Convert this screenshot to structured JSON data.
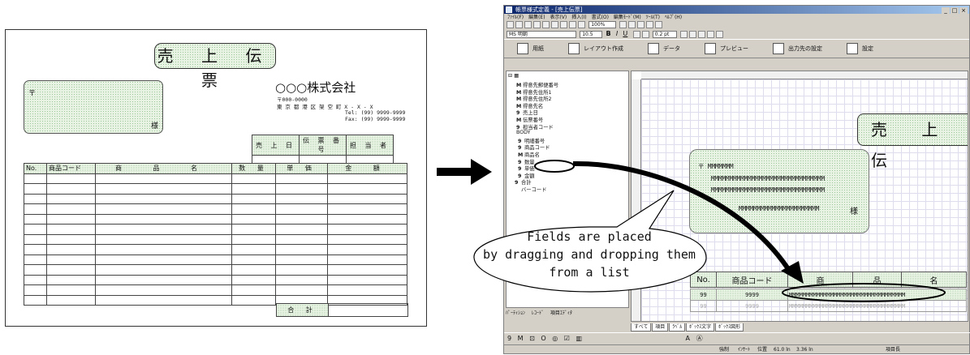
{
  "form": {
    "title": "売 上 伝 票",
    "postal_mark": "〒",
    "honorific": "様",
    "company_name": "○○○株式会社",
    "company_zip": "〒000-0000",
    "company_address": "東 京 都 港 区 架 空 町 X - X - X",
    "company_tel": "Tel: (99) 9999-9999",
    "company_fax": "Fax: (99) 9999-9999",
    "header_cols": [
      "売 上 日",
      "伝 票 番 号",
      "担 当 者"
    ],
    "item_cols": [
      "No.",
      "商品コード",
      "商 品 名",
      "数 量",
      "単 価",
      "金 額"
    ],
    "total_label": "合 計"
  },
  "window": {
    "title": "帳票様式定義 - [売上伝票]",
    "menu": [
      "ﾌｧｲﾙ(F)",
      "編集(E)",
      "表示(V)",
      "挿入(I)",
      "書式(O)",
      "編集ﾓｰﾄﾞ(M)",
      "ﾂｰﾙ(T)",
      "ﾍﾙﾌﾟ(H)"
    ],
    "font_name": "MS 明朝",
    "font_size": "10.5",
    "zoom": "100%",
    "line_width": "0.2 pt",
    "big_buttons": [
      "用紙",
      "レイアウト作成",
      "データ",
      "プレビュー",
      "出力先の設定",
      "設定"
    ],
    "tree": [
      {
        "icon": "M",
        "label": "得意先郵便番号"
      },
      {
        "icon": "M",
        "label": "得意先住所1"
      },
      {
        "icon": "M",
        "label": "得意先住所2"
      },
      {
        "icon": "M",
        "label": "得意先名"
      },
      {
        "icon": "9",
        "label": "売上日"
      },
      {
        "icon": "M",
        "label": "伝票番号"
      },
      {
        "icon": "9",
        "label": "担当者コード"
      },
      {
        "icon": "",
        "label": "BODY"
      },
      {
        "icon": "9",
        "label": "明細番号"
      },
      {
        "icon": "9",
        "label": "商品コード"
      },
      {
        "icon": "M",
        "label": "商品名"
      },
      {
        "icon": "9",
        "label": "数量"
      },
      {
        "icon": "9",
        "label": "単価"
      },
      {
        "icon": "9",
        "label": "金額"
      },
      {
        "icon": "9",
        "label": "合計"
      },
      {
        "icon": "",
        "label": "バーコード"
      }
    ],
    "canvas": {
      "title": "売 上 伝",
      "zip_field": "〒 MMMMMMM",
      "addr1": "MMMMMMMMMMMMMMMMMMMMMMMMMMMMMMM",
      "addr2": "MMMMMMMMMMMMMMMMMMMMMMMMMMMMMMM",
      "name_field": "MMMMMMMMMMMMMMMMMMMMMM",
      "honorific": "様",
      "cols": [
        "No.",
        "商品コード",
        "商",
        "品",
        "名"
      ],
      "row": [
        "99",
        "9999",
        "MMMMMMMMMMMMMMMMMMMMMMMMMMMMMMMMMM"
      ],
      "row_ghost": [
        "99",
        "9999",
        "MMMMMMMMMMMMMMMMMMMMMMMMMMMMMMMMMM"
      ]
    },
    "left_tabs": [
      "ﾊﾟｰﾃｨｼｮﾝ",
      "ﾚｺｰﾄﾞ",
      "項目ｴﾃﾞｨﾀ"
    ],
    "tabs": [
      "すべて",
      "項目",
      "ﾗﾍﾞﾙ",
      "ﾎﾞｯｸｽ文字",
      "ﾎﾞｯｸｽ図形"
    ],
    "drawbar": [
      "9",
      "M",
      "⊡",
      "O",
      "◎",
      "☑",
      "▥",
      "A",
      "Ⓐ"
    ],
    "status": [
      "強制",
      "ｲﾝｻｰﾄ",
      "位置",
      "61.0 ln",
      "3.36 ln",
      "項目長"
    ]
  },
  "callout": {
    "line1": "Fields are placed",
    "line2": "by dragging and dropping them",
    "line3": "from a list"
  },
  "colors": {
    "dot_fill": "#e8f3e4",
    "title_bar": "#0a246a",
    "window_bg": "#d4d0c8"
  }
}
